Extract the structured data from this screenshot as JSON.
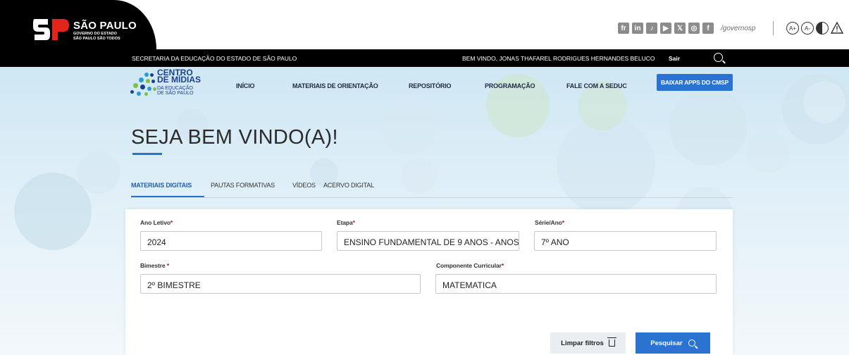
{
  "gov": {
    "brand_line1": "SÃO PAULO",
    "brand_line2": "GOVERNO DO ESTADO",
    "brand_line3": "SÃO PAULO SÃO TODOS",
    "social_icons": [
      "fr",
      "in",
      "♪",
      "▶",
      "𝕏",
      "◎",
      "f"
    ],
    "social_handle": "/governosp",
    "accessibility_icons": [
      "A+",
      "A-",
      "contrast",
      "alert"
    ]
  },
  "secbar": {
    "secretariat": "SECRETARIA DA EDUCAÇÃO DO ESTADO DE SÃO PAULO",
    "welcome": "BEM VINDO, JONAS THAFAREL RODRIGUES HERNANDES BELUCO",
    "logout": "Sair"
  },
  "brand": {
    "line1": "CENTRO",
    "line2": "DE MÍDIAS",
    "line3": "DA EDUCAÇÃO",
    "line4": "DE SÃO PAULO"
  },
  "nav": {
    "items": [
      "INÍCIO",
      "MATERIAIS DE ORIENTAÇÃO",
      "REPOSITÓRIO",
      "PROGRAMAÇÃO",
      "FALE COM A SEDUC"
    ],
    "cta": "BAIXAR APPS DO CMSP"
  },
  "hero": {
    "title": "SEJA BEM VINDO(A)!"
  },
  "tabs": [
    "MATERIAIS DIGITAIS",
    "PAUTAS FORMATIVAS",
    "VÍDEOS",
    "ACERVO DIGITAL"
  ],
  "filters": {
    "ano_letivo": {
      "label": "Ano Letivo",
      "value": "2024"
    },
    "etapa": {
      "label": "Etapa",
      "value": "ENSINO FUNDAMENTAL DE 9 ANOS - ANOS"
    },
    "serie": {
      "label": "Série/Ano",
      "value": "7º ANO"
    },
    "bimestre": {
      "label": "Bimestre",
      "value": "2º BIMESTRE"
    },
    "componente": {
      "label": "Componente Curricular",
      "value": "MATEMATICA"
    },
    "required_mark": "*",
    "required_mark_spaced": " *"
  },
  "actions": {
    "clear": "Limpar filtros",
    "search": "Pesquisar"
  },
  "colors": {
    "accent": "#2a73d0",
    "brand_navy": "#1a3f8c",
    "required": "#d0021b"
  }
}
